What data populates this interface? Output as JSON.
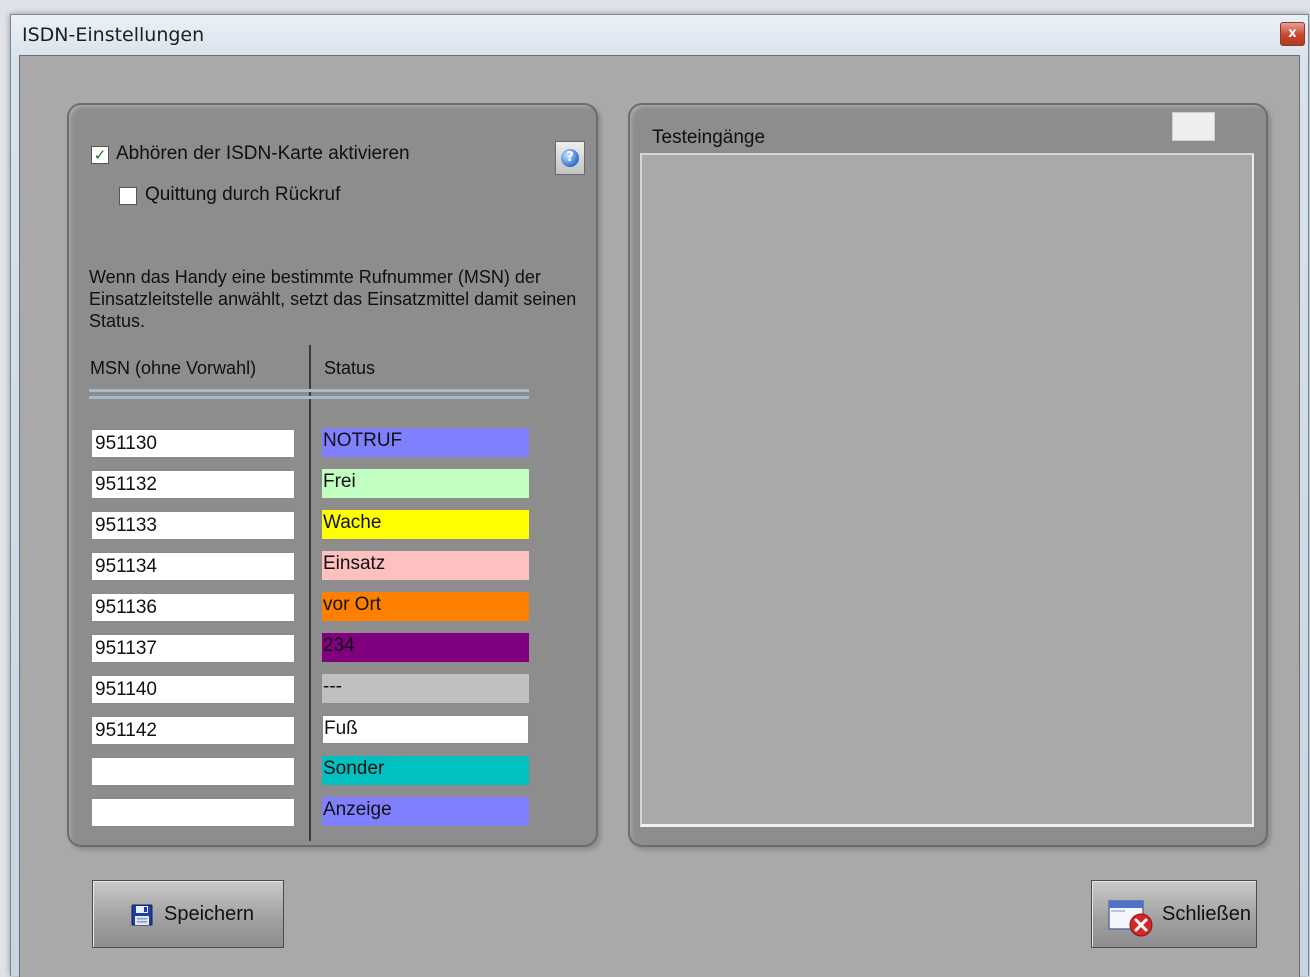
{
  "window": {
    "title": "ISDN-Einstellungen",
    "close_glyph": "x"
  },
  "options": {
    "enable_listening": {
      "label": "Abhören der ISDN-Karte aktivieren",
      "checked": true
    },
    "callback_ack": {
      "label": "Quittung durch Rückruf",
      "checked": false
    },
    "check_glyph": "✓"
  },
  "help_button": {
    "icon": "help-icon",
    "glyph": "?"
  },
  "description": "Wenn das Handy eine bestimmte Rufnummer (MSN)  der Einsatzleitstelle anwählt, setzt das Einsatzmittel damit seinen Status.",
  "table": {
    "columns": [
      "MSN (ohne Vorwahl)",
      "Status"
    ],
    "rows": [
      {
        "msn": "951130",
        "status": "NOTRUF",
        "color": "#8080ff"
      },
      {
        "msn": "951132",
        "status": "Frei",
        "color": "#c0ffc0"
      },
      {
        "msn": "951133",
        "status": "Wache",
        "color": "#ffff00"
      },
      {
        "msn": "951134",
        "status": "Einsatz",
        "color": "#ffc0c0"
      },
      {
        "msn": "951136",
        "status": "vor Ort",
        "color": "#ff8000"
      },
      {
        "msn": "951137",
        "status": "234",
        "color": "#800080"
      },
      {
        "msn": "951140",
        "status": "---",
        "color": "#c0c0c0"
      },
      {
        "msn": "951142",
        "status": "Fuß",
        "color": "#ffffff"
      },
      {
        "msn": "",
        "status": "Sonder",
        "color": "#00c0c0"
      },
      {
        "msn": "",
        "status": "Anzeige",
        "color": "#8080ff"
      }
    ]
  },
  "test_inputs": {
    "title": "Testeingänge"
  },
  "buttons": {
    "save": {
      "label": "Speichern",
      "icon": "floppy-icon"
    },
    "close": {
      "label": "Schließen",
      "icon": "window-close-icon"
    }
  }
}
